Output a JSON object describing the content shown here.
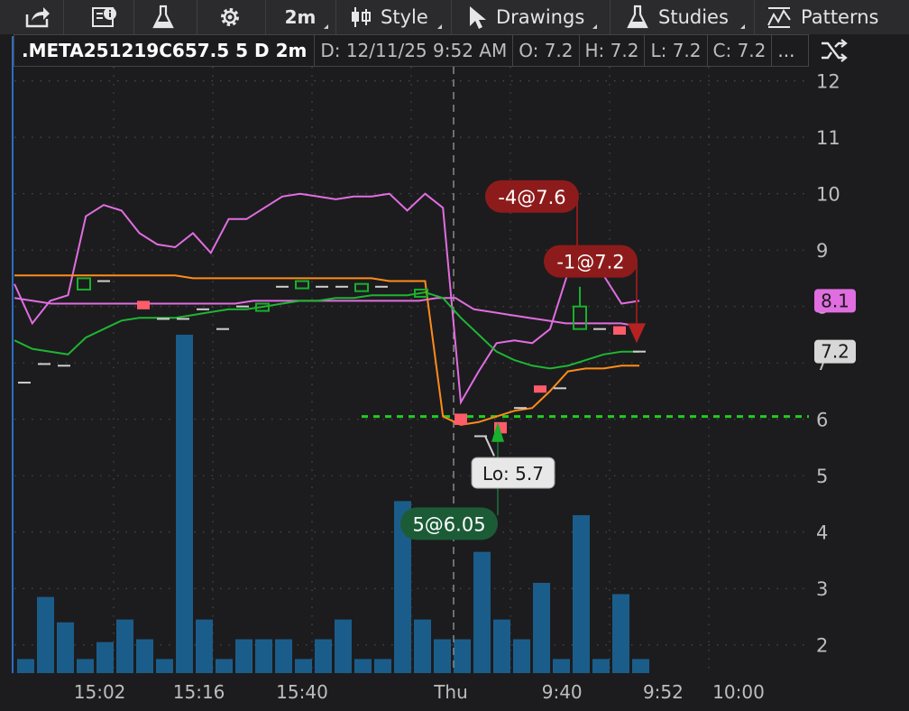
{
  "toolbar": {
    "share_icon": "share-icon",
    "info_icon": "info-icon",
    "flask_icon": "flask-icon",
    "gear_icon": "gear-icon",
    "interval": "2m",
    "style_label": "Style",
    "drawings_label": "Drawings",
    "studies_label": "Studies",
    "patterns_label": "Patterns"
  },
  "infobar": {
    "symbol": ".META251219C657.5 5 D 2m",
    "date": "D: 12/11/25 9:52 AM",
    "open": "O: 7.2",
    "high": "H: 7.2",
    "low": "L: 7.2",
    "close": "C: 7.2",
    "more": "..."
  },
  "colors": {
    "background": "#1c1c1e",
    "grid": "#4a4a4a",
    "magenta": "#e06ee0",
    "orange": "#ff8c1a",
    "green": "#1fb533",
    "volume": "#1b5d8a",
    "up_candle": "#18b02c",
    "down_candle": "#ff5c6a",
    "sell_label": "#8e1b1b",
    "buy_label": "#1b5c37",
    "support_line": "#22cc22"
  },
  "chart_data": {
    "type": "line",
    "price_axis": {
      "min": 1.5,
      "max": 12.25,
      "ticks": [
        2,
        3,
        4,
        5,
        6,
        7,
        8,
        9,
        10,
        11,
        12
      ]
    },
    "time_ticks": [
      "15:02",
      "15:16",
      "15:40",
      "Thu",
      "9:40",
      "9:52",
      "10:00"
    ],
    "slots": 40,
    "series": [
      {
        "color_key": "magenta",
        "values": [
          8.4,
          7.7,
          8.1,
          8.2,
          9.6,
          9.8,
          9.7,
          9.3,
          9.1,
          9.05,
          9.3,
          8.95,
          9.55,
          9.55,
          9.75,
          9.95,
          10.0,
          9.95,
          9.9,
          9.95,
          9.95,
          10.0,
          9.7,
          10.0,
          9.75,
          6.3,
          6.85,
          7.35,
          7.4,
          7.35,
          7.6,
          8.6,
          8.75,
          8.55,
          8.05,
          8.1
        ],
        "start_slot": 0
      },
      {
        "color_key": "magenta",
        "values": [
          8.15,
          8.1,
          8.05,
          8.05,
          8.05,
          8.05,
          8.05,
          8.05,
          8.05,
          8.05,
          8.05,
          8.05,
          8.05,
          8.1,
          8.1,
          8.1,
          8.1,
          8.1,
          8.1,
          8.1,
          8.1,
          8.1,
          8.1,
          8.15,
          8.15,
          7.95,
          7.9,
          7.85,
          7.8,
          7.75,
          7.7,
          7.7,
          7.7,
          7.7,
          7.65
        ],
        "start_slot": 0
      },
      {
        "color_key": "green",
        "values": [
          7.4,
          7.25,
          7.2,
          7.15,
          7.45,
          7.6,
          7.75,
          7.8,
          7.8,
          7.8,
          7.85,
          7.9,
          7.95,
          7.95,
          8.0,
          8.05,
          8.1,
          8.1,
          8.15,
          8.15,
          8.2,
          8.2,
          8.2,
          8.25,
          8.15,
          7.8,
          7.5,
          7.2,
          7.05,
          6.95,
          6.9,
          6.95,
          7.05,
          7.15,
          7.2,
          7.2
        ],
        "start_slot": 0
      },
      {
        "color_key": "orange",
        "values": [
          8.55,
          8.55,
          8.55,
          8.55,
          8.55,
          8.55,
          8.55,
          8.55,
          8.55,
          8.55,
          8.5,
          8.5,
          8.5,
          8.5,
          8.5,
          8.5,
          8.5,
          8.5,
          8.5,
          8.5,
          8.5,
          8.45,
          8.45,
          8.45,
          6.05,
          5.9,
          5.95,
          6.05,
          6.15,
          6.2,
          6.5,
          6.85,
          6.9,
          6.9,
          6.95,
          6.95
        ],
        "start_slot": 0
      }
    ],
    "candles": [
      {
        "slot": 0.5,
        "o": 6.65,
        "c": 6.65,
        "type": "flat"
      },
      {
        "slot": 1.5,
        "o": 6.98,
        "c": 6.98,
        "type": "flat"
      },
      {
        "slot": 2.5,
        "o": 6.95,
        "c": 6.95,
        "type": "flat"
      },
      {
        "slot": 3.5,
        "o": 8.5,
        "c": 8.3,
        "type": "up"
      },
      {
        "slot": 4.5,
        "o": 8.45,
        "c": 8.45,
        "type": "flat"
      },
      {
        "slot": 6.5,
        "o": 8.1,
        "c": 7.95,
        "type": "down"
      },
      {
        "slot": 7.5,
        "o": 7.78,
        "c": 7.78,
        "type": "flat"
      },
      {
        "slot": 8.5,
        "o": 7.78,
        "c": 7.78,
        "type": "flat"
      },
      {
        "slot": 9.5,
        "o": 7.95,
        "c": 7.95,
        "type": "flat"
      },
      {
        "slot": 10.5,
        "o": 7.6,
        "c": 7.6,
        "type": "flat"
      },
      {
        "slot": 11.5,
        "o": 8.0,
        "c": 8.0,
        "type": "flat"
      },
      {
        "slot": 12.5,
        "o": 8.05,
        "c": 8.0,
        "type": "up"
      },
      {
        "slot": 13.5,
        "o": 8.35,
        "c": 8.35,
        "type": "flat"
      },
      {
        "slot": 14.5,
        "o": 8.45,
        "c": 8.35,
        "type": "up"
      },
      {
        "slot": 15.5,
        "o": 8.35,
        "c": 8.35,
        "type": "flat"
      },
      {
        "slot": 16.5,
        "o": 8.35,
        "c": 8.35,
        "type": "flat"
      },
      {
        "slot": 17.5,
        "o": 8.4,
        "c": 8.35,
        "type": "up"
      },
      {
        "slot": 18.5,
        "o": 8.35,
        "c": 8.35,
        "type": "flat"
      },
      {
        "slot": 20.5,
        "o": 8.3,
        "c": 8.2,
        "type": "up"
      },
      {
        "slot": 22.5,
        "o": 6.1,
        "c": 5.9,
        "type": "down"
      },
      {
        "slot": 23.5,
        "o": 5.7,
        "c": 5.7,
        "type": "flat"
      },
      {
        "slot": 24.5,
        "o": 5.95,
        "c": 5.75,
        "type": "down"
      },
      {
        "slot": 25.5,
        "o": 6.2,
        "c": 6.2,
        "type": "flat"
      },
      {
        "slot": 26.5,
        "o": 6.6,
        "c": 6.5,
        "type": "down"
      },
      {
        "slot": 27.5,
        "o": 6.55,
        "c": 6.55,
        "type": "flat"
      },
      {
        "slot": 28.5,
        "o": 8.0,
        "c": 7.6,
        "type": "up",
        "wick_hi": 8.35
      },
      {
        "slot": 29.5,
        "o": 7.6,
        "c": 7.6,
        "type": "flat"
      },
      {
        "slot": 30.5,
        "o": 7.65,
        "c": 7.5,
        "type": "down"
      },
      {
        "slot": 31.5,
        "o": 7.2,
        "c": 7.2,
        "type": "flat"
      }
    ],
    "volume": [
      0.25,
      1.35,
      0.9,
      0.25,
      0.55,
      0.95,
      0.6,
      0.25,
      6.0,
      0.95,
      0.25,
      0.6,
      0.6,
      0.6,
      0.25,
      0.6,
      0.95,
      0.25,
      0.25,
      3.05,
      0.95,
      0.6,
      0.6,
      2.15,
      0.95,
      0.6,
      1.6,
      0.25,
      2.8,
      0.25,
      1.4,
      0.25
    ],
    "volume_scale_max": 12.25,
    "support_level": 6.05,
    "session_divider_slot": 22.0,
    "price_badges": [
      {
        "text": "8.1",
        "value": 8.1,
        "color_key": "magenta"
      },
      {
        "text": "7.2",
        "value": 7.2,
        "color_key": "flat"
      }
    ],
    "trade_labels": [
      {
        "text": "-4@7.6",
        "side": "sell",
        "value": 9.95
      },
      {
        "text": "-1@7.2",
        "side": "sell",
        "value": 8.8
      },
      {
        "text": "5@6.05",
        "side": "buy",
        "value": 4.15
      }
    ],
    "lo_label": "Lo: 5.7"
  }
}
